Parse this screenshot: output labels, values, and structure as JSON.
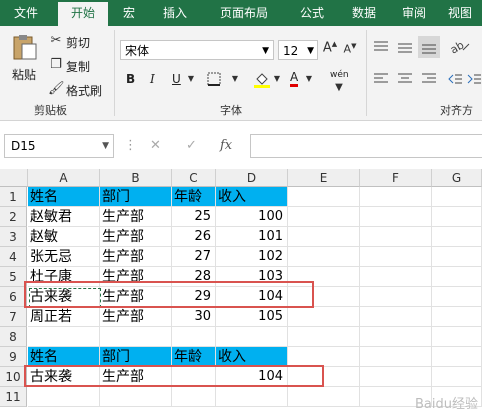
{
  "tabs": [
    "文件",
    "开始",
    "宏",
    "插入",
    "页面布局",
    "公式",
    "数据",
    "审阅",
    "视图"
  ],
  "active_tab": "开始",
  "clipboard": {
    "paste": "粘贴",
    "cut": "剪切",
    "copy": "复制",
    "format_painter": "格式刷",
    "group": "剪贴板"
  },
  "font": {
    "name": "宋体",
    "size": "12",
    "group": "字体",
    "bold": "B",
    "italic": "I",
    "underline": "U",
    "wen": "wén",
    "font_color_letter": "A"
  },
  "alignment": {
    "group": "对齐方"
  },
  "formula_bar": {
    "name_box": "D15",
    "fx": "fx",
    "cancel": "✕",
    "enter": "✓",
    "value": ""
  },
  "columns": [
    "A",
    "B",
    "C",
    "D",
    "E",
    "F",
    "G"
  ],
  "rows": [
    "1",
    "2",
    "3",
    "4",
    "5",
    "6",
    "7",
    "8",
    "9",
    "10",
    "11"
  ],
  "sheet": {
    "r1": [
      "姓名",
      "部门",
      "年龄",
      "收入"
    ],
    "r2": [
      "赵敏君",
      "生产部",
      "25",
      "100"
    ],
    "r3": [
      "赵敏",
      "生产部",
      "26",
      "101"
    ],
    "r4": [
      "张无忌",
      "生产部",
      "27",
      "102"
    ],
    "r5": [
      "杜子康",
      "生产部",
      "28",
      "103"
    ],
    "r6": [
      "古来袭",
      "生产部",
      "29",
      "104"
    ],
    "r7": [
      "周正若",
      "生产部",
      "30",
      "105"
    ],
    "r9": [
      "姓名",
      "部门",
      "年龄",
      "收入"
    ],
    "r10": [
      "古来袭",
      "生产部",
      "",
      "104"
    ]
  },
  "colors": {
    "ribbon": "#217346",
    "header_fill": "#00b0f0",
    "highlight_box": "#d9534f"
  },
  "watermark": "Baidu经验"
}
